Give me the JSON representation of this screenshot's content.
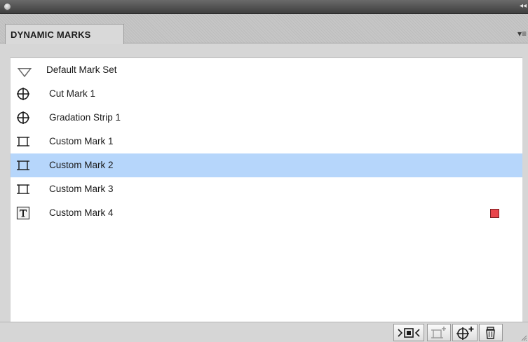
{
  "panel": {
    "title": "DYNAMIC MARKS"
  },
  "list": {
    "items": [
      {
        "label": "Default Mark Set",
        "icon": "disclosure-triangle-icon",
        "selected": false
      },
      {
        "label": "Cut Mark 1",
        "icon": "crosshair-circle-icon",
        "selected": false
      },
      {
        "label": "Gradation Strip 1",
        "icon": "crosshair-circle-icon",
        "selected": false
      },
      {
        "label": "Custom Mark 1",
        "icon": "custom-frame-icon",
        "selected": false
      },
      {
        "label": "Custom Mark 2",
        "icon": "custom-frame-icon",
        "selected": true
      },
      {
        "label": "Custom Mark 3",
        "icon": "custom-frame-icon",
        "selected": false
      },
      {
        "label": "Custom Mark 4",
        "icon": "text-mark-icon",
        "selected": false,
        "swatch_color": "#e8454b"
      }
    ]
  },
  "toolbar": {
    "buttons": [
      {
        "name": "fit-marks-button",
        "icon": "fit-to-frame-icon"
      },
      {
        "name": "new-custom-mark-button",
        "icon": "new-custom-mark-icon",
        "disabled": true
      },
      {
        "name": "new-mark-button",
        "icon": "new-crosshair-mark-icon"
      },
      {
        "name": "delete-button",
        "icon": "trash-icon"
      }
    ]
  },
  "colors": {
    "selection": "#b6d6fb",
    "swatch": "#e8454b"
  }
}
